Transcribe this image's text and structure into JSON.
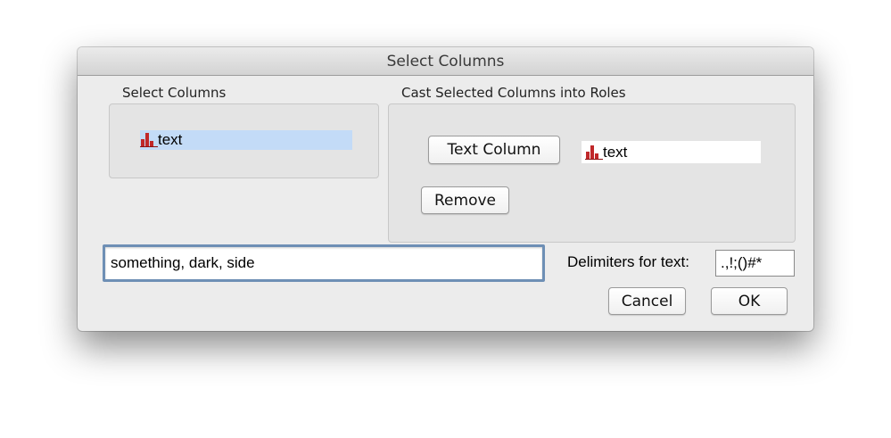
{
  "dialog": {
    "title": "Select Columns"
  },
  "select_columns": {
    "label": "Select Columns",
    "items": [
      {
        "label": "text",
        "icon": "bar-chart-icon",
        "selected": true
      }
    ]
  },
  "cast_roles": {
    "label": "Cast Selected Columns into Roles",
    "text_column_button": "Text Column",
    "text_column_value": "text",
    "remove_button": "Remove"
  },
  "search": {
    "value": "something, dark, side"
  },
  "delimiters": {
    "label": "Delimiters for text:",
    "value": ".,!;()#*"
  },
  "footer": {
    "cancel_label": "Cancel",
    "ok_label": "OK"
  },
  "colors": {
    "selection": "#c3dbf7",
    "icon_red": "#c0282a",
    "focus_ring": "#6e8fb5"
  }
}
